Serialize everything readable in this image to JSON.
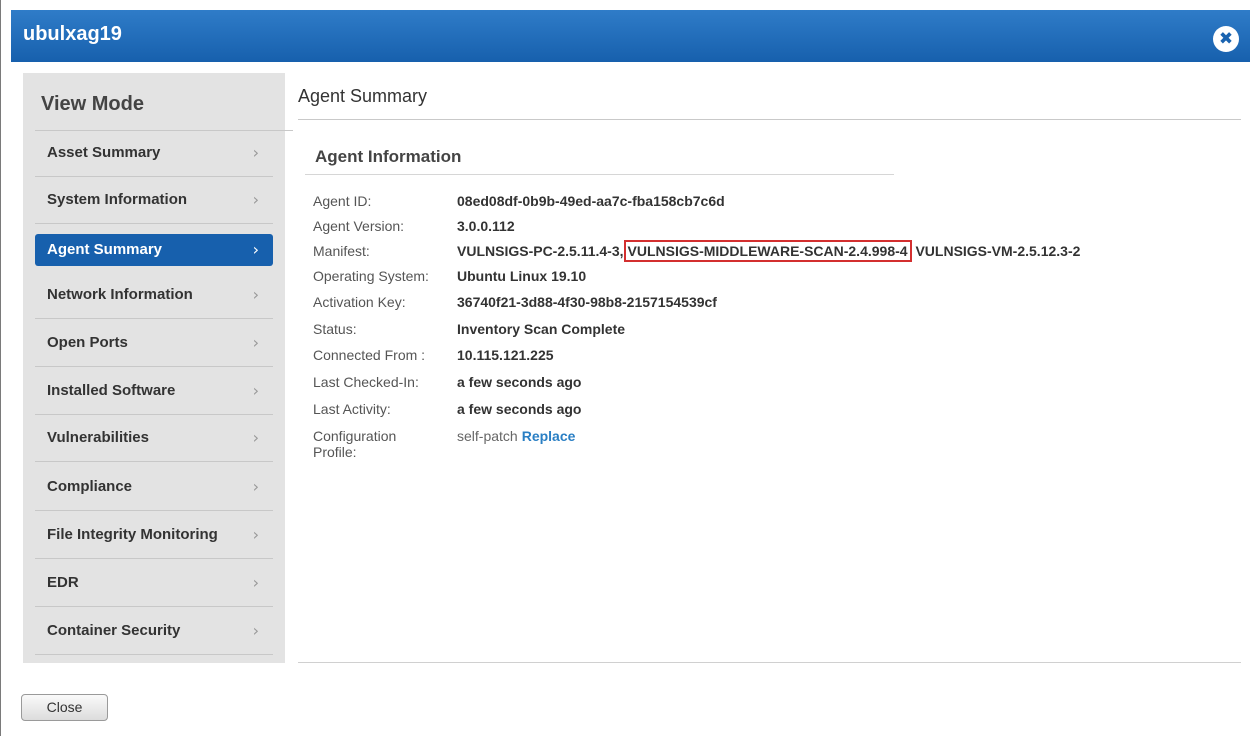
{
  "window": {
    "title": "ubulxag19",
    "close_icon_glyph": "✖"
  },
  "sidebar": {
    "mode_title": "View Mode",
    "chevron_glyph": "›",
    "items": [
      {
        "label": "Asset Summary",
        "active": false
      },
      {
        "label": "System Information",
        "active": false
      },
      {
        "label": "Agent Summary",
        "active": true
      },
      {
        "label": "Network Information",
        "active": false
      },
      {
        "label": "Open Ports",
        "active": false
      },
      {
        "label": "Installed Software",
        "active": false
      },
      {
        "label": "Vulnerabilities",
        "active": false
      },
      {
        "label": "Compliance",
        "active": false
      },
      {
        "label": "File Integrity Monitoring",
        "active": false
      },
      {
        "label": "EDR",
        "active": false
      },
      {
        "label": "Container Security",
        "active": false
      }
    ]
  },
  "main": {
    "title": "Agent Summary",
    "section_title": "Agent Information",
    "fields": {
      "agent_id": {
        "label": "Agent ID:",
        "value": "08ed08df-0b9b-49ed-aa7c-fba158cb7c6d"
      },
      "agent_version": {
        "label": "Agent Version:",
        "value": "3.0.0.112"
      },
      "manifest": {
        "label": "Manifest:",
        "part1": "VULNSIGS-PC-2.5.11.4-3,",
        "part2_highlighted": "VULNSIGS-MIDDLEWARE-SCAN-2.4.998-4",
        "part3": "VULNSIGS-VM-2.5.12.3-2"
      },
      "os": {
        "label": "Operating System:",
        "value": "Ubuntu Linux 19.10"
      },
      "activation_key": {
        "label": "Activation Key:",
        "value": "36740f21-3d88-4f30-98b8-2157154539cf"
      },
      "status": {
        "label": "Status:",
        "value": "Inventory Scan Complete"
      },
      "connected_from": {
        "label": "Connected From :",
        "value": "10.115.121.225"
      },
      "last_checked_in": {
        "label": "Last Checked-In:",
        "value": "a few seconds ago"
      },
      "last_activity": {
        "label": "Last Activity:",
        "value": "a few seconds ago"
      },
      "config_profile": {
        "label_line1": "Configuration",
        "label_line2": "Profile:",
        "value": "self-patch",
        "link": "Replace"
      }
    }
  },
  "footer": {
    "close_label": "Close"
  },
  "colors": {
    "title_bar": "#1760ad",
    "active_nav": "#1760ad",
    "highlight_border": "#d32f2f",
    "link": "#2a7fc4"
  }
}
